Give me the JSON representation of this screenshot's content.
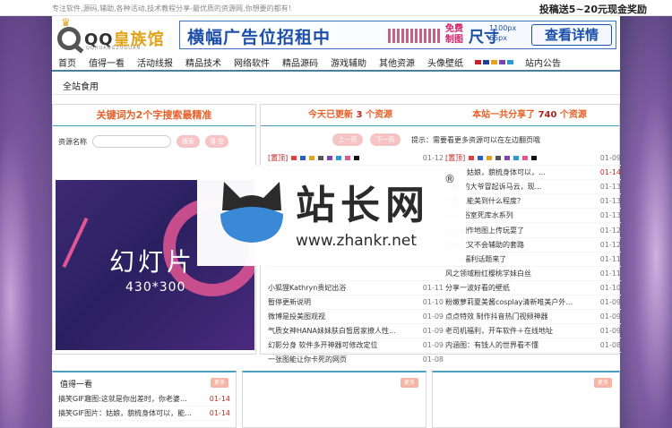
{
  "topbar": {
    "tagline": "专注软件,源码,辅助,各种活动,技术教程分享-最优质的资源网,你想要的都有！",
    "promo": "投稿送5~20元现金奖励"
  },
  "logo": {
    "name_a": "QQ",
    "name_b": "皇族馆",
    "sub": "QQHUANGZUGUAN",
    "crown": "♛"
  },
  "banner": {
    "headline": "横幅广告位招租中",
    "free_line1": "免费",
    "free_line2": "制图",
    "spec_main": "尺寸",
    "spec_line1": "1100px",
    "spec_line2": "65px",
    "cta": "查看详情"
  },
  "nav": {
    "items": [
      "首页",
      "值得一看",
      "活动线报",
      "精品技术",
      "网络软件",
      "精品源码",
      "游戏辅助",
      "其他资源",
      "头像壁纸",
      "站内公告"
    ],
    "swatches": [
      "#c8202c",
      "#1c3fa0",
      "#e6a11b",
      "#7b44b5",
      "#2a9ad0"
    ]
  },
  "subbar": {
    "label": "全站食用"
  },
  "search_panel": {
    "title": "关键词为2个字搜索最精准",
    "field_label": "资源名称",
    "search_button": "搜索",
    "clear_button": "清 空"
  },
  "slide": {
    "title": "幻灯片",
    "size": "430*300"
  },
  "stats": {
    "today_prefix": "今天已更新",
    "today_count": "3",
    "today_suffix": "个资源",
    "total_prefix": "本站一共分享了",
    "total_count": "740",
    "total_suffix": "个资源"
  },
  "pager": {
    "prev": "上一页",
    "next": "下一页",
    "hint": "提示：需要看更多资源可以在左边翻页哦"
  },
  "list_left": [
    {
      "tag": "[置顶]",
      "title": "",
      "date": "01-12",
      "hot": false,
      "swatch": true
    },
    {
      "tag": "",
      "title": "",
      "date": "",
      "hot": false
    },
    {
      "tag": "",
      "title": "",
      "date": "",
      "hot": false
    },
    {
      "tag": "",
      "title": "",
      "date": "",
      "hot": false
    },
    {
      "tag": "",
      "title": "",
      "date": "",
      "hot": false
    },
    {
      "tag": "",
      "title": "",
      "date": "",
      "hot": false
    },
    {
      "tag": "",
      "title": "",
      "date": "",
      "hot": false
    },
    {
      "tag": "",
      "title": "",
      "date": "",
      "hot": false
    },
    {
      "tag": "",
      "title": "",
      "date": "",
      "hot": false
    },
    {
      "tag": "",
      "title": "小狐狸Kathryn贵妃出浴",
      "date": "01-11",
      "hot": false
    },
    {
      "tag": "",
      "title": "暂停更新说明",
      "date": "01-10",
      "hot": false
    },
    {
      "tag": "",
      "title": "微博是投美图观视",
      "date": "01-09",
      "hot": false
    },
    {
      "tag": "",
      "title": "气质女神HANA妹妹肤白皙居家撩人性...",
      "date": "01-09",
      "hot": false
    },
    {
      "tag": "",
      "title": "幻影分身 软件多开神器可修改定位",
      "date": "01-09",
      "hot": false
    },
    {
      "tag": "",
      "title": "一张图能让你卡死的网页",
      "date": "01-08",
      "hot": false
    }
  ],
  "list_right": [
    {
      "tag": "[置顶]",
      "title": "",
      "date": "01-09",
      "hot": false,
      "swatch": true
    },
    {
      "tag": "",
      "title": "图片：姑娘，貌梳身体可以，...",
      "date": "01-14",
      "hot": true
    },
    {
      "tag": "",
      "title": "讨饭\"的大爷冒起诉马云，现...",
      "date": "01-13",
      "hot": false
    },
    {
      "tag": "",
      "title": "一些人能美到什么程度？",
      "date": "01-13",
      "hot": false
    },
    {
      "tag": "",
      "title": "andy浴室死库水系列",
      "date": "01-13",
      "hot": false
    },
    {
      "tag": "",
      "title": "自己制作地图上传玩耍了",
      "date": "01-12",
      "hot": false
    },
    {
      "tag": "",
      "title": "同收款又不会辅助的套路",
      "date": "01-12",
      "hot": false
    },
    {
      "tag": "",
      "title": "\"Y\"疑福利话题来了",
      "date": "01-11",
      "hot": false
    },
    {
      "tag": "",
      "title": "风之领域粉红樱桃学妹白丝",
      "date": "01-11",
      "hot": false
    },
    {
      "tag": "",
      "title": "分享一波好看的壁纸",
      "date": "01-10",
      "hot": false
    },
    {
      "tag": "",
      "title": "粉嫩萝莉夏美酱cosplay清新唯美户外...",
      "date": "01-09",
      "hot": false
    },
    {
      "tag": "",
      "title": "点点特效 制作抖音热门视频神器",
      "date": "01-09",
      "hot": false
    },
    {
      "tag": "",
      "title": "老司机福利，开车软件＋在线地址",
      "date": "01-09",
      "hot": false
    },
    {
      "tag": "",
      "title": "内涵图：有钱人的世界看不懂",
      "date": "01-08",
      "hot": false
    }
  ],
  "row_swatches": [
    "#e04040",
    "#2a60c0",
    "#e6a11b",
    "#555555",
    "#7b44b5",
    "#2a9ad0",
    "#e25694",
    "#111111"
  ],
  "bottom": [
    {
      "title": "值得一看",
      "more": "更多",
      "rows": [
        {
          "title": "搞笑GIF趣图:这就是你出差时，你老婆在家的...",
          "date": "01-14"
        },
        {
          "title": "搞笑GIF图片：姑娘，貌梳身体可以，能不能找...",
          "date": "01-14"
        }
      ]
    },
    {
      "title": "",
      "more": "更多",
      "rows": []
    },
    {
      "title": "",
      "more": "更多",
      "rows": []
    }
  ],
  "watermark": {
    "brand": "站长网",
    "reg": "®",
    "url": "www.zhankr.net"
  }
}
